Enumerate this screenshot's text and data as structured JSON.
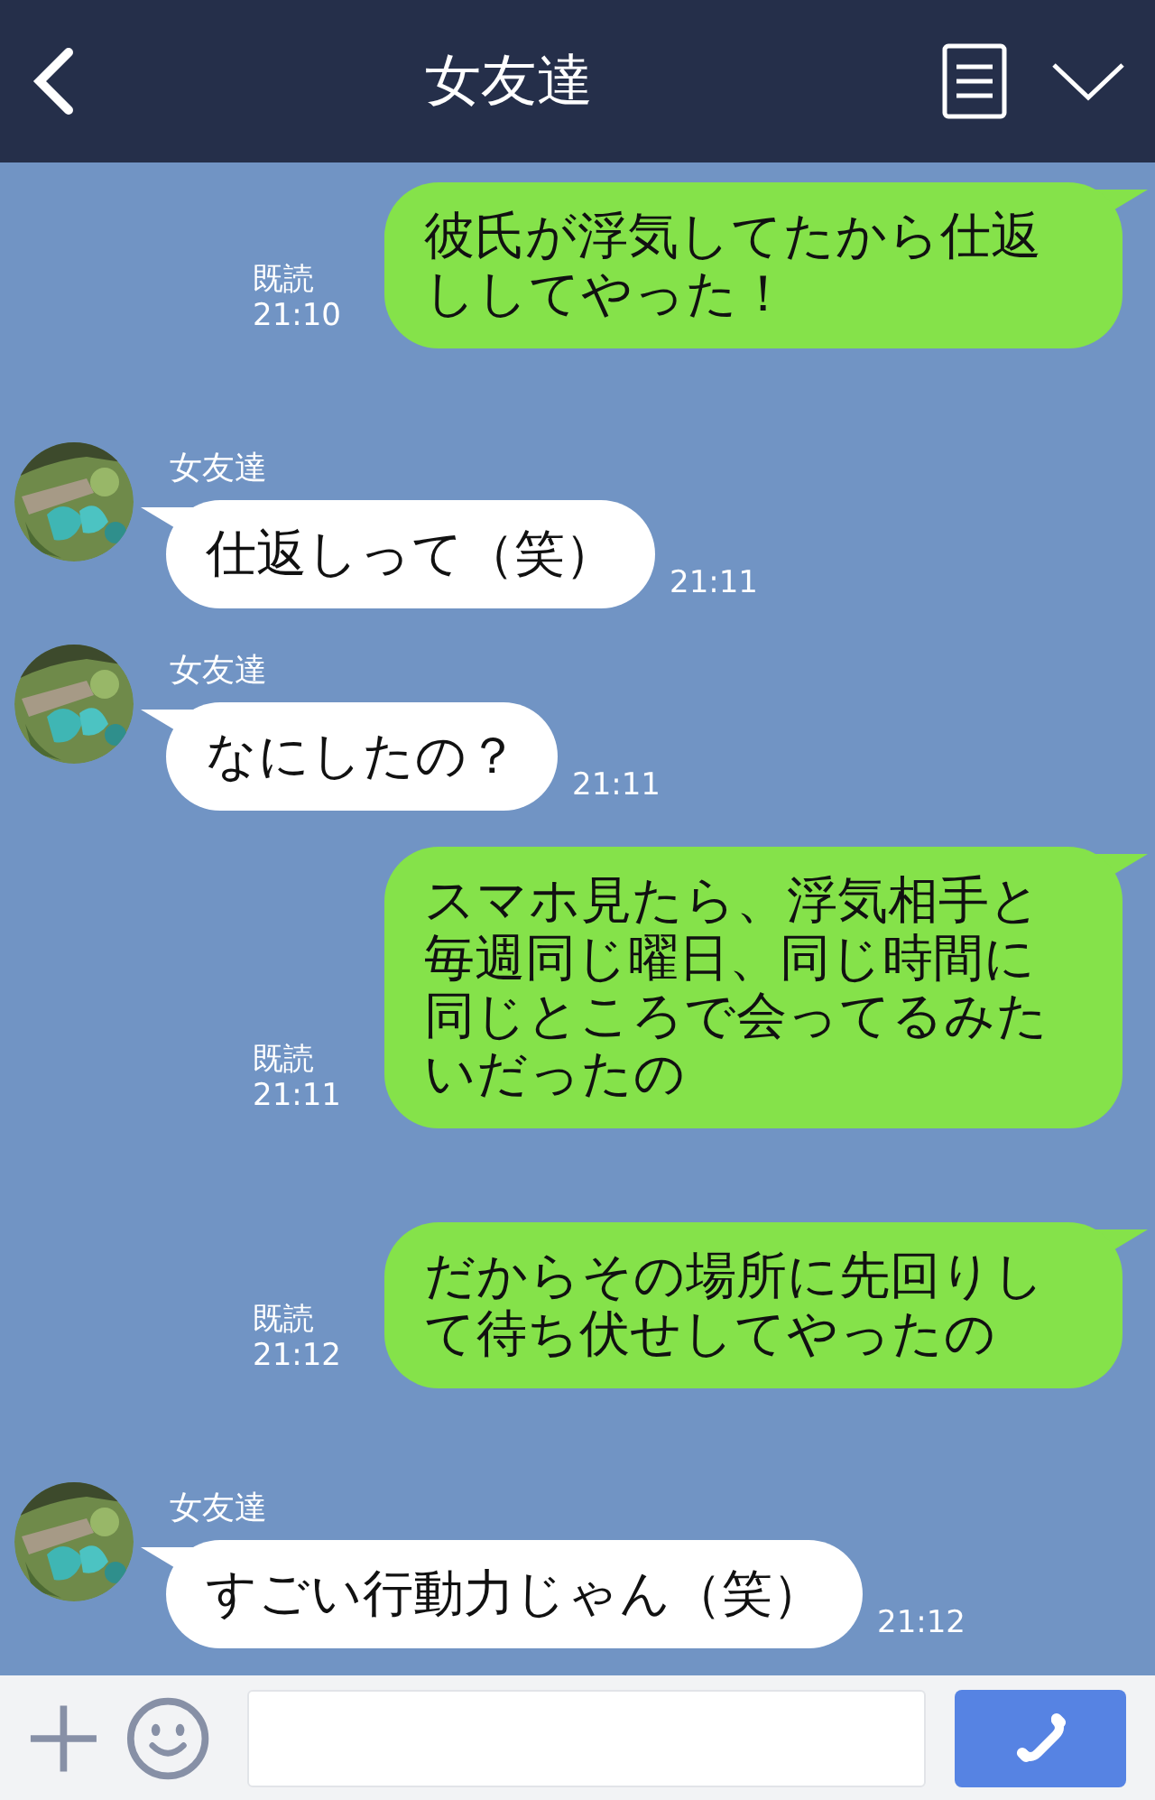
{
  "header": {
    "title": "女友達"
  },
  "messages": [
    {
      "kind": "sent",
      "text": "彼氏が浮気してたから仕返ししてやった！",
      "read": "既読",
      "time": "21:10"
    },
    {
      "kind": "received",
      "name": "女友達",
      "text": "仕返しって（笑）",
      "time": "21:11"
    },
    {
      "kind": "received",
      "name": "女友達",
      "text": "なにしたの？",
      "time": "21:11"
    },
    {
      "kind": "sent",
      "text": "スマホ見たら、浮気相手と毎週同じ曜日、同じ時間に同じところで会ってるみたいだったの",
      "read": "既読",
      "time": "21:11"
    },
    {
      "kind": "sent",
      "text": "だからその場所に先回りして待ち伏せしてやったの",
      "read": "既読",
      "time": "21:12"
    },
    {
      "kind": "received",
      "name": "女友達",
      "text": "すごい行動力じゃん（笑）",
      "time": "21:12"
    }
  ]
}
